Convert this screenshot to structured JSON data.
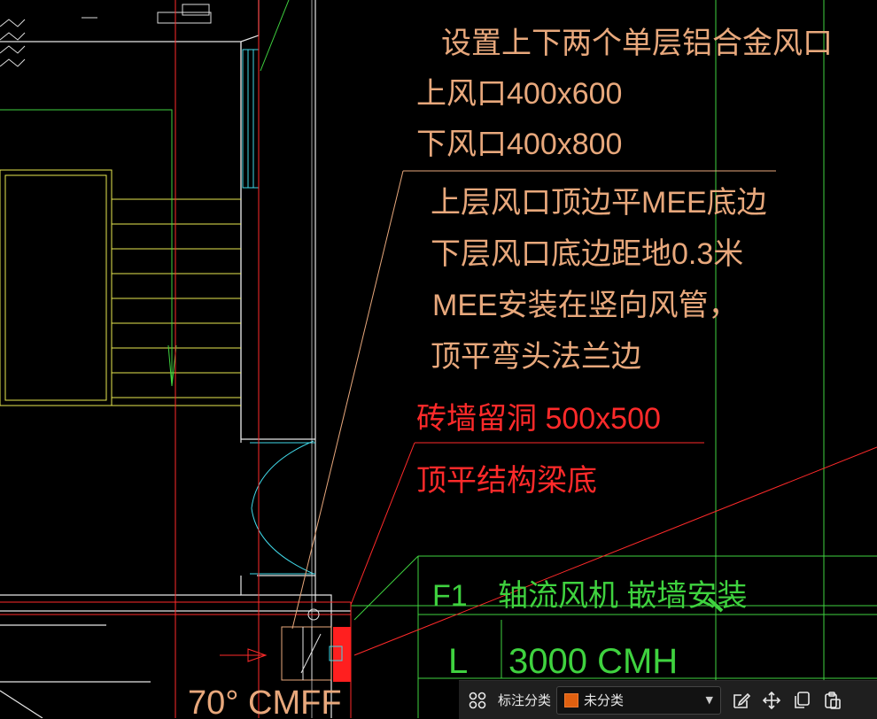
{
  "drawing": {
    "notes": [
      "设置上下两个单层铝合金风口",
      "上风口400x600",
      "下风口400x800",
      "上层风口顶边平MEE底边",
      "下层风口底边距地0.3米",
      "MEE安装在竖向风管，",
      "顶平弯头法兰边"
    ],
    "red_notes": [
      "砖墙留洞 500x500",
      "顶平结构梁底"
    ],
    "fan_tag": "F1",
    "fan_desc": "轴流风机 嵌墙安装",
    "fan_l": "L",
    "fan_flow": "3000 CMH",
    "bottom_text": "70° CMFF"
  },
  "toolbar": {
    "label": "标注分类",
    "select_value": "未分类",
    "icons": [
      "grid-icon",
      "edit-icon",
      "move-icon",
      "copy-icon",
      "paste-icon"
    ]
  },
  "colors": {
    "note": "#e8a87c",
    "red": "#ff2a2a",
    "green": "#3fd23f",
    "yellow": "#e8e850",
    "cyan": "#40d8e8",
    "white": "#e6e6e6"
  }
}
